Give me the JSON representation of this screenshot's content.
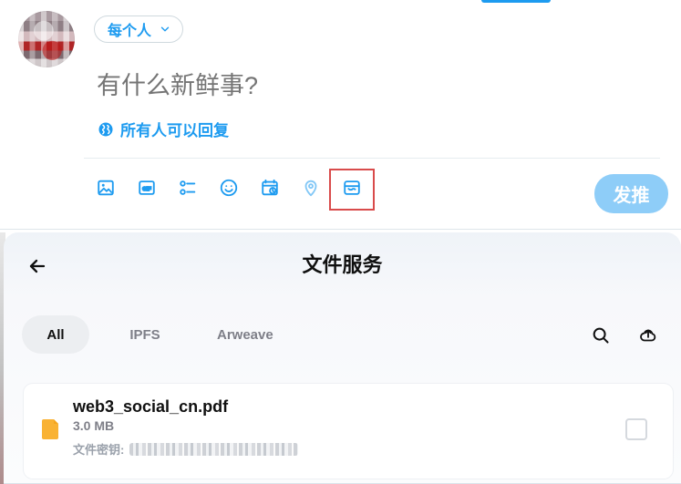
{
  "composer": {
    "audience_label": "每个人",
    "input_placeholder": "有什么新鲜事?",
    "reply_setting": "所有人可以回复",
    "post_button": "发推"
  },
  "tools": [
    {
      "name": "image-icon"
    },
    {
      "name": "gif-icon"
    },
    {
      "name": "poll-icon"
    },
    {
      "name": "emoji-icon"
    },
    {
      "name": "schedule-icon"
    },
    {
      "name": "location-icon"
    },
    {
      "name": "file-service-icon"
    }
  ],
  "file_panel": {
    "title": "文件服务",
    "tabs": [
      {
        "label": "All",
        "active": true
      },
      {
        "label": "IPFS",
        "active": false
      },
      {
        "label": "Arweave",
        "active": false
      }
    ],
    "file": {
      "name": "web3_social_cn.pdf",
      "size": "3.0 MB",
      "key_label": "文件密钥:"
    }
  },
  "colors": {
    "accent": "#1d9bf0",
    "highlight": "#d94b4b",
    "file_icon": "#f9b233"
  }
}
